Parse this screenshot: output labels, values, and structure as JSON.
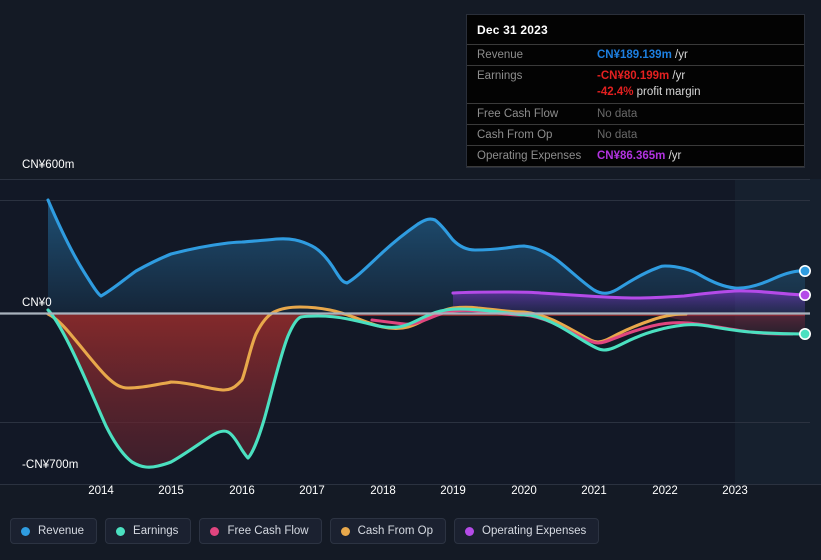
{
  "chart_data": {
    "type": "line",
    "title": "",
    "xlabel": "",
    "ylabel": "",
    "currency": "CN¥",
    "y_axis": {
      "top_label": "CN¥600m",
      "zero_label": "CN¥0",
      "bottom_label": "-CN¥700m",
      "ylim": [
        -700,
        600
      ],
      "gridlines": [
        600,
        0,
        -400
      ]
    },
    "x_axis": {
      "tick_labels": [
        "2014",
        "2015",
        "2016",
        "2017",
        "2018",
        "2019",
        "2020",
        "2021",
        "2022",
        "2023"
      ],
      "range": [
        "2013-06",
        "2024-03"
      ]
    },
    "grid": true,
    "legend_position": "bottom-left",
    "forecast_region_start": "2023-06",
    "series": [
      {
        "name": "Revenue",
        "color": "#2f9ce0",
        "x": [
          "2013.5",
          "2014.0",
          "2014.5",
          "2015.0",
          "2015.5",
          "2016.0",
          "2016.5",
          "2017.0",
          "2017.5",
          "2018.0",
          "2018.5",
          "2019.0",
          "2019.5",
          "2020.0",
          "2020.5",
          "2021.0",
          "2021.5",
          "2022.0",
          "2022.5",
          "2023.0",
          "2023.5",
          "2024.0"
        ],
        "values": [
          600,
          430,
          330,
          288,
          318,
          350,
          360,
          378,
          350,
          300,
          345,
          400,
          420,
          400,
          382,
          388,
          350,
          298,
          300,
          320,
          312,
          260
        ],
        "endpoint_value": 189.139
      },
      {
        "name": "Earnings",
        "color": "#4be0c0",
        "x": [
          "2013.5",
          "2014.0",
          "2014.5",
          "2015.0",
          "2015.5",
          "2016.0",
          "2016.5",
          "2017.0",
          "2017.5",
          "2018.0",
          "2018.5",
          "2019.0",
          "2019.5",
          "2020.0",
          "2020.5",
          "2021.0",
          "2021.5",
          "2022.0",
          "2022.5",
          "2023.0",
          "2023.5",
          "2024.0"
        ],
        "values": [
          -10,
          -180,
          -455,
          -520,
          -690,
          -590,
          -8,
          -6,
          -60,
          -130,
          -90,
          -30,
          6,
          -8,
          -14,
          -50,
          -95,
          -60,
          -12,
          -30,
          -45,
          -80.199
        ],
        "endpoint_value": -80.199
      },
      {
        "name": "Free Cash Flow",
        "color": "#e0457f",
        "x": [
          "2018.8",
          "2019.0",
          "2019.5",
          "2020.0",
          "2020.5",
          "2021.0",
          "2021.5",
          "2022.0",
          "2022.5",
          "2023.0"
        ],
        "values": [
          -20,
          -25,
          -50,
          -105,
          -70,
          -22,
          -10,
          -18,
          -32,
          -40
        ],
        "endpoint_value": null,
        "note": "No data at Dec 31 2023"
      },
      {
        "name": "Cash From Op",
        "color": "#e8a84b",
        "x": [
          "2013.5",
          "2014.0",
          "2014.5",
          "2015.0",
          "2015.5",
          "2016.0",
          "2016.5",
          "2017.0",
          "2017.5",
          "2018.0",
          "2018.5",
          "2019.0",
          "2019.5",
          "2020.0",
          "2020.5",
          "2021.0",
          "2021.5",
          "2022.0",
          "2022.5",
          "2023.0"
        ],
        "values": [
          -12,
          -130,
          -300,
          -320,
          -350,
          -300,
          12,
          10,
          -40,
          -115,
          -75,
          -12,
          12,
          8,
          2,
          -38,
          -80,
          -42,
          4,
          10
        ],
        "endpoint_value": null,
        "note": "No data at Dec 31 2023"
      },
      {
        "name": "Operating Expenses",
        "color": "#b44be8",
        "x": [
          "2018.85",
          "2019.0",
          "2019.5",
          "2020.0",
          "2020.5",
          "2021.0",
          "2021.5",
          "2022.0",
          "2022.5",
          "2023.0",
          "2023.5",
          "2024.0"
        ],
        "values": [
          58,
          60,
          62,
          65,
          64,
          62,
          64,
          66,
          70,
          74,
          80,
          86.365
        ],
        "endpoint_value": 86.365
      }
    ]
  },
  "tooltip": {
    "title": "Dec 31 2023",
    "rows": [
      {
        "label": "Revenue",
        "value": "CN¥189.139m",
        "value_color": "#1d7fe0",
        "suffix": " /yr",
        "nodata": false
      },
      {
        "label": "Earnings",
        "value": "-CN¥80.199m",
        "value_color": "#e32020",
        "suffix": " /yr",
        "nodata": false
      },
      {
        "label": "",
        "value": "-42.4%",
        "value_color": "#e32020",
        "suffix": " profit margin",
        "nodata": false,
        "is_sub": true
      },
      {
        "label": "Free Cash Flow",
        "value": "No data",
        "value_color": "#6a6a6a",
        "suffix": "",
        "nodata": true
      },
      {
        "label": "Cash From Op",
        "value": "No data",
        "value_color": "#6a6a6a",
        "suffix": "",
        "nodata": true
      },
      {
        "label": "Operating Expenses",
        "value": "CN¥86.365m",
        "value_color": "#b233e0",
        "suffix": " /yr",
        "nodata": false
      }
    ]
  },
  "legend": {
    "items": [
      {
        "label": "Revenue",
        "color": "#2f9ce0"
      },
      {
        "label": "Earnings",
        "color": "#4be0c0"
      },
      {
        "label": "Free Cash Flow",
        "color": "#e0457f"
      },
      {
        "label": "Cash From Op",
        "color": "#e8a84b"
      },
      {
        "label": "Operating Expenses",
        "color": "#b44be8"
      }
    ]
  }
}
